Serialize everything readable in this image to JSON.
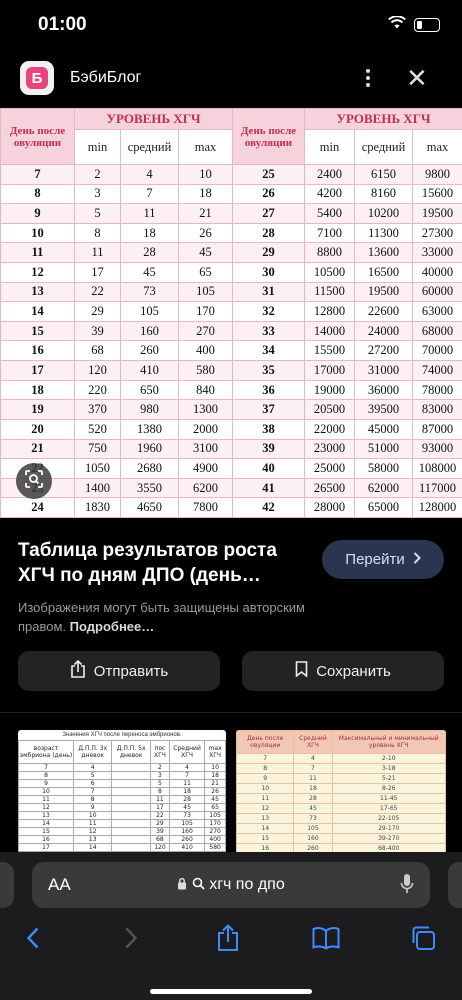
{
  "status_bar": {
    "time": "01:00"
  },
  "header": {
    "site_name": "БэбиБлог",
    "logo_letter": "Б"
  },
  "table": {
    "day_header": "День после овуляции",
    "level_header": "УРОВЕНЬ ХГЧ",
    "col_min": "min",
    "col_mid": "средний",
    "col_max": "max",
    "left_rows": [
      [
        "7",
        "2",
        "4",
        "10"
      ],
      [
        "8",
        "3",
        "7",
        "18"
      ],
      [
        "9",
        "5",
        "11",
        "21"
      ],
      [
        "10",
        "8",
        "18",
        "26"
      ],
      [
        "11",
        "11",
        "28",
        "45"
      ],
      [
        "12",
        "17",
        "45",
        "65"
      ],
      [
        "13",
        "22",
        "73",
        "105"
      ],
      [
        "14",
        "29",
        "105",
        "170"
      ],
      [
        "15",
        "39",
        "160",
        "270"
      ],
      [
        "16",
        "68",
        "260",
        "400"
      ],
      [
        "17",
        "120",
        "410",
        "580"
      ],
      [
        "18",
        "220",
        "650",
        "840"
      ],
      [
        "19",
        "370",
        "980",
        "1300"
      ],
      [
        "20",
        "520",
        "1380",
        "2000"
      ],
      [
        "21",
        "750",
        "1960",
        "3100"
      ],
      [
        "22",
        "1050",
        "2680",
        "4900"
      ],
      [
        "23",
        "1400",
        "3550",
        "6200"
      ],
      [
        "24",
        "1830",
        "4650",
        "7800"
      ]
    ],
    "right_rows": [
      [
        "25",
        "2400",
        "6150",
        "9800"
      ],
      [
        "26",
        "4200",
        "8160",
        "15600"
      ],
      [
        "27",
        "5400",
        "10200",
        "19500"
      ],
      [
        "28",
        "7100",
        "11300",
        "27300"
      ],
      [
        "29",
        "8800",
        "13600",
        "33000"
      ],
      [
        "30",
        "10500",
        "16500",
        "40000"
      ],
      [
        "31",
        "11500",
        "19500",
        "60000"
      ],
      [
        "32",
        "12800",
        "22600",
        "63000"
      ],
      [
        "33",
        "14000",
        "24000",
        "68000"
      ],
      [
        "34",
        "15500",
        "27200",
        "70000"
      ],
      [
        "35",
        "17000",
        "31000",
        "74000"
      ],
      [
        "36",
        "19000",
        "36000",
        "78000"
      ],
      [
        "37",
        "20500",
        "39500",
        "83000"
      ],
      [
        "38",
        "22000",
        "45000",
        "87000"
      ],
      [
        "39",
        "23000",
        "51000",
        "93000"
      ],
      [
        "40",
        "25000",
        "58000",
        "108000"
      ],
      [
        "41",
        "26500",
        "62000",
        "117000"
      ],
      [
        "42",
        "28000",
        "65000",
        "128000"
      ]
    ]
  },
  "result": {
    "title": "Таблица результатов роста ХГЧ по дням ДПО (день…",
    "go_button": "Перейти",
    "copyright_text": "Изображения могут быть защищены авторским правом.",
    "more_link": "Подробнее…",
    "share_button": "Отправить",
    "save_button": "Сохранить"
  },
  "thumbnails": {
    "first_caption": "Значения ХГЧ после переноса эмбрионов.",
    "first_headers": [
      "возраст эмбриона (день)",
      "Д.П.П. 3х дневок",
      "Д.П.П. 5х дневок",
      "пос ХГЧ",
      "Средний ХГЧ",
      "max ХГЧ"
    ],
    "first_rows": [
      [
        "7",
        "4",
        "",
        "2",
        "4",
        "10"
      ],
      [
        "8",
        "5",
        "",
        "3",
        "7",
        "18"
      ],
      [
        "9",
        "6",
        "",
        "5",
        "11",
        "21"
      ],
      [
        "10",
        "7",
        "",
        "8",
        "18",
        "26"
      ],
      [
        "11",
        "8",
        "",
        "11",
        "28",
        "45"
      ],
      [
        "12",
        "9",
        "",
        "17",
        "45",
        "65"
      ],
      [
        "13",
        "10",
        "",
        "22",
        "73",
        "105"
      ],
      [
        "14",
        "11",
        "",
        "29",
        "105",
        "170"
      ],
      [
        "15",
        "12",
        "",
        "39",
        "160",
        "270"
      ],
      [
        "16",
        "13",
        "",
        "68",
        "260",
        "400"
      ],
      [
        "17",
        "14",
        "",
        "120",
        "410",
        "580"
      ]
    ],
    "second_headers": [
      "День после овуляции",
      "Средний ХГЧ",
      "Максимальный и минимальный уровень ХГЧ"
    ],
    "second_rows": [
      [
        "7",
        "4",
        "2-10"
      ],
      [
        "8",
        "7",
        "3-18"
      ],
      [
        "9",
        "11",
        "5-21"
      ],
      [
        "10",
        "18",
        "8-26"
      ],
      [
        "11",
        "28",
        "11-45"
      ],
      [
        "12",
        "45",
        "17-65"
      ],
      [
        "13",
        "73",
        "22-105"
      ],
      [
        "14",
        "105",
        "29-170"
      ],
      [
        "15",
        "160",
        "39-270"
      ],
      [
        "16",
        "260",
        "68-400"
      ]
    ]
  },
  "browser": {
    "aa_label": "AA",
    "url_text": "хгч по дпо"
  }
}
